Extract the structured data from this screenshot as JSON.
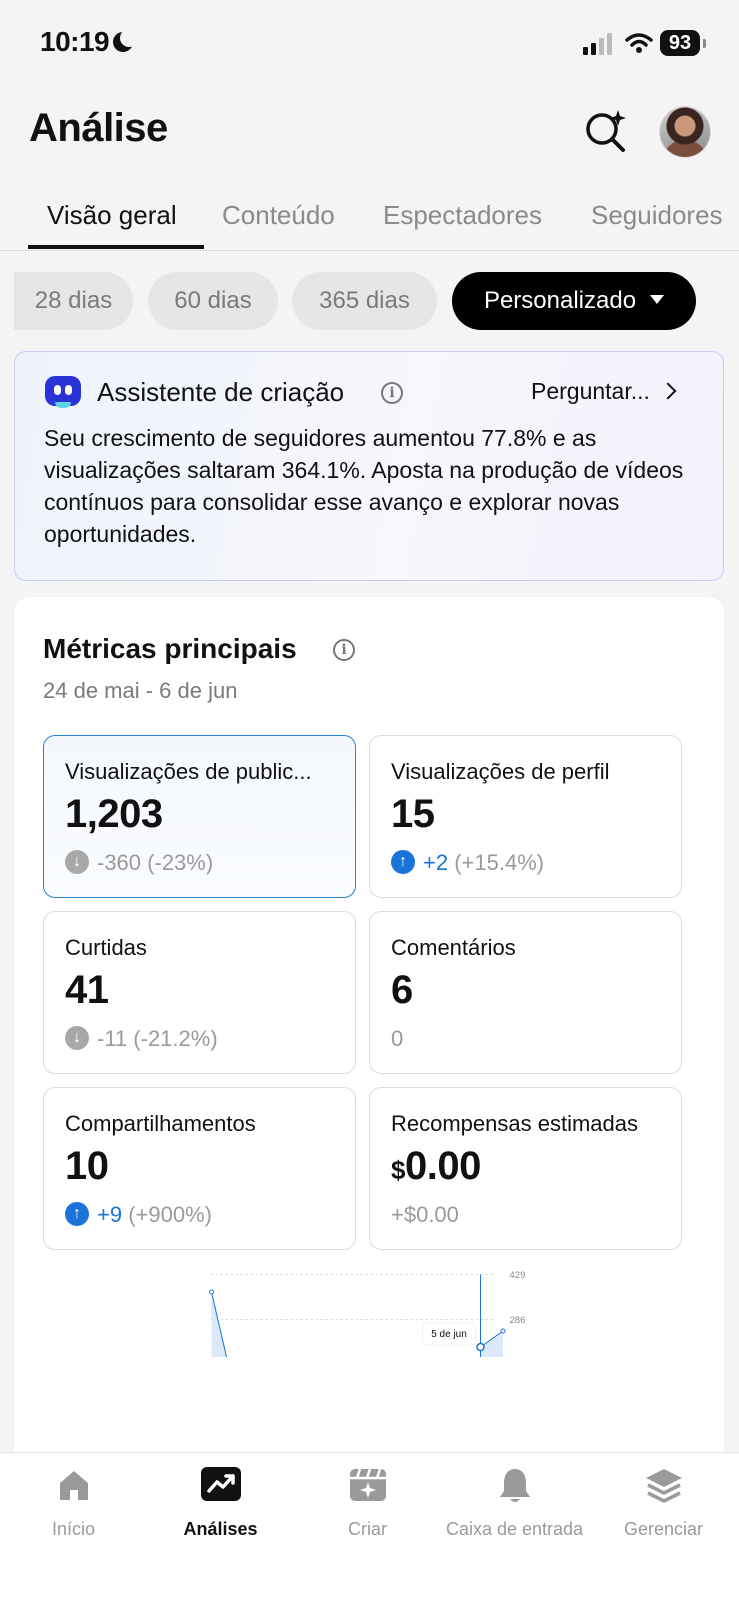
{
  "status_bar": {
    "time": "10:19",
    "battery": "93"
  },
  "header": {
    "title": "Análise"
  },
  "tabs": [
    {
      "label": "Visão geral",
      "active": true
    },
    {
      "label": "Conteúdo"
    },
    {
      "label": "Espectadores"
    },
    {
      "label": "Seguidores"
    }
  ],
  "ranges": [
    {
      "label": "28 dias"
    },
    {
      "label": "60 dias"
    },
    {
      "label": "365 dias"
    },
    {
      "label": "Personalizado",
      "active": true
    }
  ],
  "assistant": {
    "title": "Assistente de criação",
    "ask_label": "Perguntar...",
    "text": "Seu crescimento de seguidores aumentou 77.8% e as visualizações saltaram 364.1%. Aposta na produção de vídeos contínuos para consolidar esse avanço e explorar novas oportunidades."
  },
  "metrics": {
    "title": "Métricas principais",
    "date_range": "24 de mai - 6 de jun",
    "tiles": [
      {
        "label": "Visualizações de public...",
        "value": "1,203",
        "direction": "down",
        "change": "-360",
        "pct": "(-23%)"
      },
      {
        "label": "Visualizações de perfil",
        "value": "15",
        "direction": "up",
        "change": "+2",
        "pct": "(+15.4%)"
      },
      {
        "label": "Curtidas",
        "value": "41",
        "direction": "down",
        "change": "-11",
        "pct": "(-21.2%)"
      },
      {
        "label": "Comentários",
        "value": "6",
        "direction": "none",
        "change": "0",
        "pct": ""
      },
      {
        "label": "Compartilhamentos",
        "value": "10",
        "direction": "up",
        "change": "+9",
        "pct": "(+900%)"
      },
      {
        "label": "Recompensas estimadas",
        "currency": "$",
        "value": "0.00",
        "direction": "none",
        "change": "+$0.00",
        "pct": ""
      }
    ]
  },
  "chart_data": {
    "type": "line",
    "y_ticks": [
      "429",
      "286"
    ],
    "tooltip": "5 de jun",
    "colors": {
      "line": "#1a73d9",
      "fill": "#dbe9f8"
    }
  },
  "bottom_nav": [
    {
      "label": "Início",
      "icon": "home-icon"
    },
    {
      "label": "Análises",
      "icon": "analytics-icon",
      "active": true
    },
    {
      "label": "Criar",
      "icon": "create-icon"
    },
    {
      "label": "Caixa de entrada",
      "icon": "bell-icon"
    },
    {
      "label": "Gerenciar",
      "icon": "layers-icon"
    }
  ]
}
